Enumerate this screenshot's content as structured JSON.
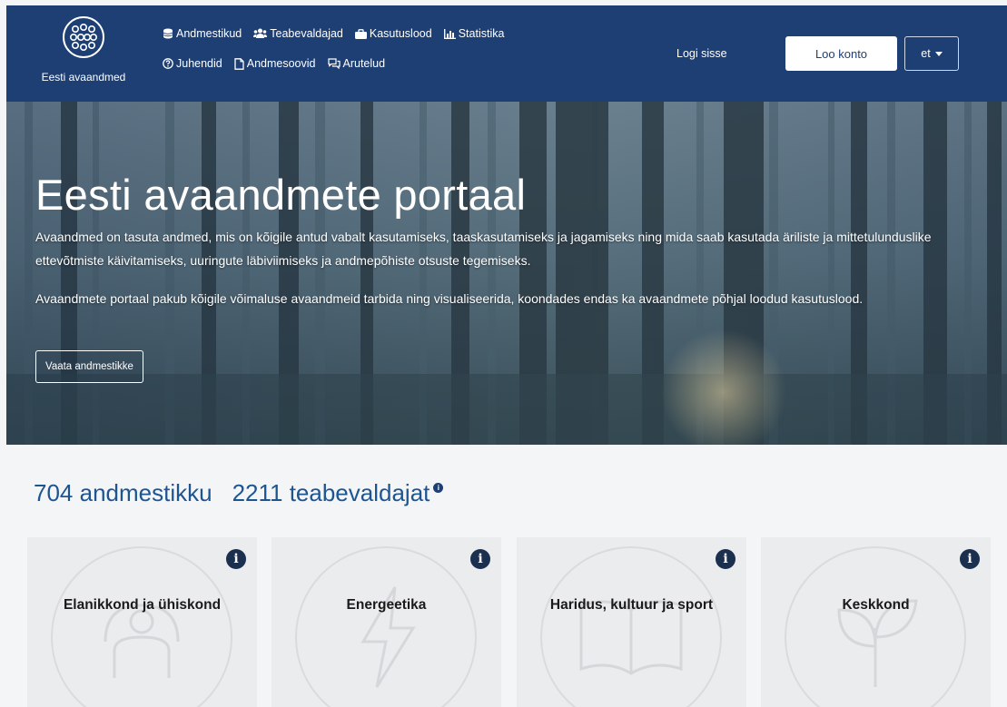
{
  "header": {
    "site_name": "Eesti avaandmed",
    "nav_row1": [
      {
        "label": "Andmestikud",
        "icon": "database-icon"
      },
      {
        "label": "Teabevaldajad",
        "icon": "users-icon"
      },
      {
        "label": "Kasutuslood",
        "icon": "briefcase-icon"
      },
      {
        "label": "Statistika",
        "icon": "bar-chart-icon"
      }
    ],
    "nav_row2": [
      {
        "label": "Juhendid",
        "icon": "question-circle-icon"
      },
      {
        "label": "Andmesoovid",
        "icon": "file-icon"
      },
      {
        "label": "Arutelud",
        "icon": "comments-icon"
      }
    ],
    "login_label": "Logi sisse",
    "create_account_label": "Loo konto",
    "language": "et",
    "brand_color": "#1d3f74"
  },
  "hero": {
    "title": "Eesti avaandmete portaal",
    "paragraph1": "Avaandmed on tasuta andmed, mis on kõigile antud vabalt kasutamiseks, taaskasutamiseks ja jagamiseks ning mida saab kasutada äriliste ja mittetulunduslike ettevõtmiste käivitamiseks, uuringute läbiviimiseks ja andmepõhiste otsuste tegemiseks.",
    "paragraph2": "Avaandmete portaal pakub kõigile võimaluse avaandmeid tarbida ning visualiseerida, koondades endas ka avaandmete põhjal loodud kasutuslood.",
    "button_label": "Vaata andmestikke"
  },
  "stats": {
    "datasets": "704 andmestikku",
    "publishers": "2211 teabevaldajat"
  },
  "categories": [
    {
      "title": "Elanikkond ja ühiskond",
      "icon": "people-icon"
    },
    {
      "title": "Energeetika",
      "icon": "lightning-icon"
    },
    {
      "title": "Haridus, kultuur ja sport",
      "icon": "book-icon"
    },
    {
      "title": "Keskkond",
      "icon": "leaf-icon"
    }
  ]
}
